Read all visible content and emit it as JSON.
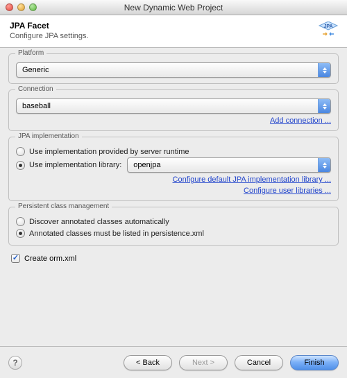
{
  "window": {
    "title": "New Dynamic Web Project"
  },
  "header": {
    "title": "JPA Facet",
    "subtitle": "Configure JPA settings."
  },
  "badge_text": "JPA",
  "platform": {
    "label": "Platform",
    "value": "Generic"
  },
  "connection": {
    "label": "Connection",
    "value": "baseball",
    "add_link": "Add connection ..."
  },
  "implementation": {
    "label": "JPA implementation",
    "opt_server": "Use implementation provided by server runtime",
    "opt_library": "Use implementation library:",
    "library_value": "openjpa",
    "configure_default_link": "Configure default JPA implementation library ...",
    "configure_user_link": "Configure user libraries ..."
  },
  "persistent": {
    "label": "Persistent class management",
    "opt_discover": "Discover annotated classes automatically",
    "opt_listed": "Annotated classes must be listed in persistence.xml"
  },
  "orm_checkbox": "Create orm.xml",
  "buttons": {
    "back": "< Back",
    "next": "Next >",
    "cancel": "Cancel",
    "finish": "Finish"
  }
}
